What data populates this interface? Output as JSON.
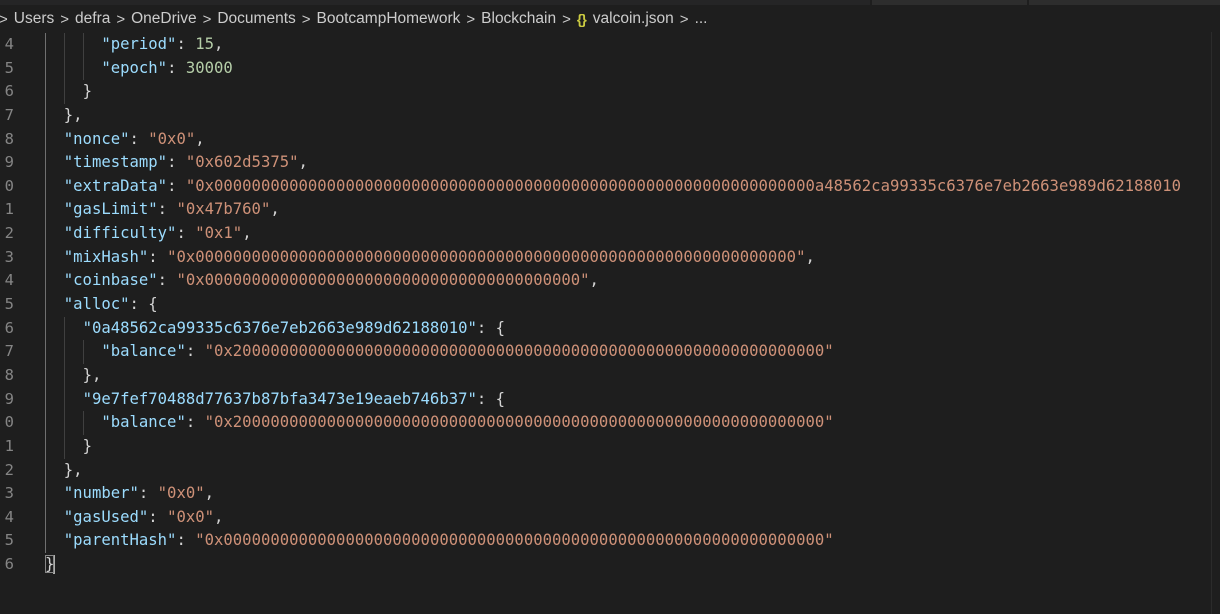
{
  "breadcrumb": {
    "items": [
      "Users",
      "defra",
      "OneDrive",
      "Documents",
      "BootcampHomework",
      "Blockchain",
      "valcoin.json",
      "..."
    ],
    "separator": ">",
    "file_icon": "{}"
  },
  "editor": {
    "line_numbers": [
      "4",
      "5",
      "6",
      "7",
      "8",
      "9",
      "0",
      "1",
      "2",
      "3",
      "4",
      "5",
      "6",
      "7",
      "8",
      "9",
      "0",
      "1",
      "2",
      "3",
      "4",
      "5",
      "6"
    ],
    "lines": [
      {
        "indent": "      ",
        "tokens": [
          [
            "k",
            "\"period\""
          ],
          [
            "p",
            ": "
          ],
          [
            "n",
            "15"
          ],
          [
            "p",
            ","
          ]
        ]
      },
      {
        "indent": "      ",
        "tokens": [
          [
            "k",
            "\"epoch\""
          ],
          [
            "p",
            ": "
          ],
          [
            "n",
            "30000"
          ]
        ]
      },
      {
        "indent": "    ",
        "tokens": [
          [
            "p",
            "}"
          ]
        ]
      },
      {
        "indent": "  ",
        "tokens": [
          [
            "p",
            "},"
          ]
        ]
      },
      {
        "indent": "  ",
        "tokens": [
          [
            "k",
            "\"nonce\""
          ],
          [
            "p",
            ": "
          ],
          [
            "s",
            "\"0x0\""
          ],
          [
            "p",
            ","
          ]
        ]
      },
      {
        "indent": "  ",
        "tokens": [
          [
            "k",
            "\"timestamp\""
          ],
          [
            "p",
            ": "
          ],
          [
            "s",
            "\"0x602d5375\""
          ],
          [
            "p",
            ","
          ]
        ]
      },
      {
        "indent": "  ",
        "tokens": [
          [
            "k",
            "\"extraData\""
          ],
          [
            "p",
            ": "
          ],
          [
            "s",
            "\"0x0000000000000000000000000000000000000000000000000000000000000000a48562ca99335c6376e7eb2663e989d62188010"
          ]
        ]
      },
      {
        "indent": "  ",
        "tokens": [
          [
            "k",
            "\"gasLimit\""
          ],
          [
            "p",
            ": "
          ],
          [
            "s",
            "\"0x47b760\""
          ],
          [
            "p",
            ","
          ]
        ]
      },
      {
        "indent": "  ",
        "tokens": [
          [
            "k",
            "\"difficulty\""
          ],
          [
            "p",
            ": "
          ],
          [
            "s",
            "\"0x1\""
          ],
          [
            "p",
            ","
          ]
        ]
      },
      {
        "indent": "  ",
        "tokens": [
          [
            "k",
            "\"mixHash\""
          ],
          [
            "p",
            ": "
          ],
          [
            "s",
            "\"0x0000000000000000000000000000000000000000000000000000000000000000\""
          ],
          [
            "p",
            ","
          ]
        ]
      },
      {
        "indent": "  ",
        "tokens": [
          [
            "k",
            "\"coinbase\""
          ],
          [
            "p",
            ": "
          ],
          [
            "s",
            "\"0x0000000000000000000000000000000000000000\""
          ],
          [
            "p",
            ","
          ]
        ]
      },
      {
        "indent": "  ",
        "tokens": [
          [
            "k",
            "\"alloc\""
          ],
          [
            "p",
            ": {"
          ]
        ]
      },
      {
        "indent": "    ",
        "tokens": [
          [
            "k",
            "\"0a48562ca99335c6376e7eb2663e989d62188010\""
          ],
          [
            "p",
            ": {"
          ]
        ]
      },
      {
        "indent": "      ",
        "tokens": [
          [
            "k",
            "\"balance\""
          ],
          [
            "p",
            ": "
          ],
          [
            "s",
            "\"0x200000000000000000000000000000000000000000000000000000000000000\""
          ]
        ]
      },
      {
        "indent": "    ",
        "tokens": [
          [
            "p",
            "},"
          ]
        ]
      },
      {
        "indent": "    ",
        "tokens": [
          [
            "k",
            "\"9e7fef70488d77637b87bfa3473e19eaeb746b37\""
          ],
          [
            "p",
            ": {"
          ]
        ]
      },
      {
        "indent": "      ",
        "tokens": [
          [
            "k",
            "\"balance\""
          ],
          [
            "p",
            ": "
          ],
          [
            "s",
            "\"0x200000000000000000000000000000000000000000000000000000000000000\""
          ]
        ]
      },
      {
        "indent": "    ",
        "tokens": [
          [
            "p",
            "}"
          ]
        ]
      },
      {
        "indent": "  ",
        "tokens": [
          [
            "p",
            "},"
          ]
        ]
      },
      {
        "indent": "  ",
        "tokens": [
          [
            "k",
            "\"number\""
          ],
          [
            "p",
            ": "
          ],
          [
            "s",
            "\"0x0\""
          ],
          [
            "p",
            ","
          ]
        ]
      },
      {
        "indent": "  ",
        "tokens": [
          [
            "k",
            "\"gasUsed\""
          ],
          [
            "p",
            ": "
          ],
          [
            "s",
            "\"0x0\""
          ],
          [
            "p",
            ","
          ]
        ]
      },
      {
        "indent": "  ",
        "tokens": [
          [
            "k",
            "\"parentHash\""
          ],
          [
            "p",
            ": "
          ],
          [
            "s",
            "\"0x0000000000000000000000000000000000000000000000000000000000000000\""
          ]
        ]
      },
      {
        "indent": "",
        "tokens": [
          [
            "p",
            "}"
          ]
        ]
      }
    ]
  },
  "colors": {
    "background": "#1e1e1e",
    "key": "#9cdcfe",
    "string": "#ce9178",
    "number": "#b5cea8",
    "punctuation": "#d4d4d4",
    "line_number": "#858585"
  }
}
